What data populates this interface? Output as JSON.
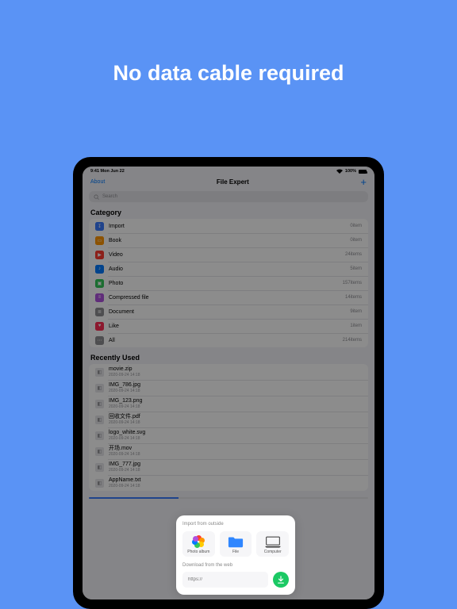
{
  "headline": "No data cable required",
  "status": {
    "time_date": "9:41 Mon Jun 22",
    "battery": "100%"
  },
  "navbar": {
    "left": "About",
    "title": "File Expert",
    "plus": "+"
  },
  "search": {
    "placeholder": "Search"
  },
  "sections": {
    "category": "Category",
    "recent": "Recently Used"
  },
  "categories": [
    {
      "label": "Import",
      "meta": "0item",
      "color": "#3a7afe",
      "icon": "↧"
    },
    {
      "label": "Book",
      "meta": "0item",
      "color": "#ff9500",
      "icon": "▭"
    },
    {
      "label": "Video",
      "meta": "24items",
      "color": "#ff3b30",
      "icon": "▶"
    },
    {
      "label": "Audio",
      "meta": "5item",
      "color": "#007aff",
      "icon": "♪"
    },
    {
      "label": "Photo",
      "meta": "157items",
      "color": "#34c759",
      "icon": "▣"
    },
    {
      "label": "Compressed file",
      "meta": "14items",
      "color": "#af52de",
      "icon": "≡"
    },
    {
      "label": "Document",
      "meta": "9item",
      "color": "#8e8e93",
      "icon": "≣"
    },
    {
      "label": "Like",
      "meta": "1item",
      "color": "#ff2d55",
      "icon": "♥"
    },
    {
      "label": "All",
      "meta": "214items",
      "color": "#8e8e93",
      "icon": "⋯"
    }
  ],
  "recent": [
    {
      "label": "movie.zip",
      "sub": "2020-09-24 14:18"
    },
    {
      "label": "IMG_786.jpg",
      "sub": "2020-09-24 14:18"
    },
    {
      "label": "IMG_123.png",
      "sub": "2020-09-24 14:18"
    },
    {
      "label": "回收文件.pdf",
      "sub": "2020-09-24 14:18"
    },
    {
      "label": "logo_white.svg",
      "sub": "2020-09-24 14:18"
    },
    {
      "label": "开场.mov",
      "sub": "2020-09-24 14:18"
    },
    {
      "label": "IMG_777.jpg",
      "sub": "2020-09-24 14:18"
    },
    {
      "label": "AppName.txt",
      "sub": "2020-09-24 14:18"
    }
  ],
  "card": {
    "import_title": "Import from outside",
    "opts": [
      {
        "label": "Photo album"
      },
      {
        "label": "File"
      },
      {
        "label": "Computer"
      }
    ],
    "download_title": "Download from the web",
    "url_placeholder": "https://"
  }
}
